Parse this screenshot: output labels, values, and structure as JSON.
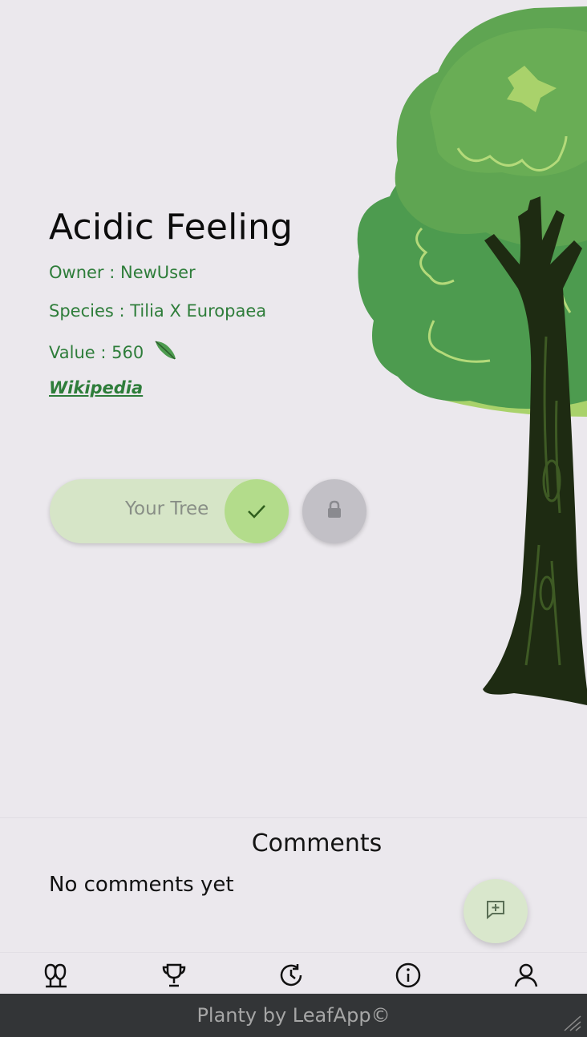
{
  "tree": {
    "name": "Acidic Feeling",
    "owner": "Owner : NewUser",
    "species": "Species : Tilia X Europaea",
    "value": "Value : 560",
    "wiki_link": "Wikipedia",
    "leaf_icon": "leaf-icon"
  },
  "actions": {
    "your_tree_label": "Your Tree",
    "check_icon": "check-icon",
    "lock_icon": "lock-icon"
  },
  "comments": {
    "title": "Comments",
    "empty_text": "No comments yet",
    "add_icon": "add-comment-icon"
  },
  "nav": {
    "items": [
      "trees-icon",
      "trophy-icon",
      "history-icon",
      "info-icon",
      "profile-icon"
    ]
  },
  "footer": {
    "text": "Planty by LeafApp©"
  },
  "colors": {
    "background": "#ebe8ed",
    "accent_green": "#2e7d3a",
    "pill": "#d6e5c7",
    "check_circle": "#b3dc8b",
    "footer": "#333537"
  }
}
